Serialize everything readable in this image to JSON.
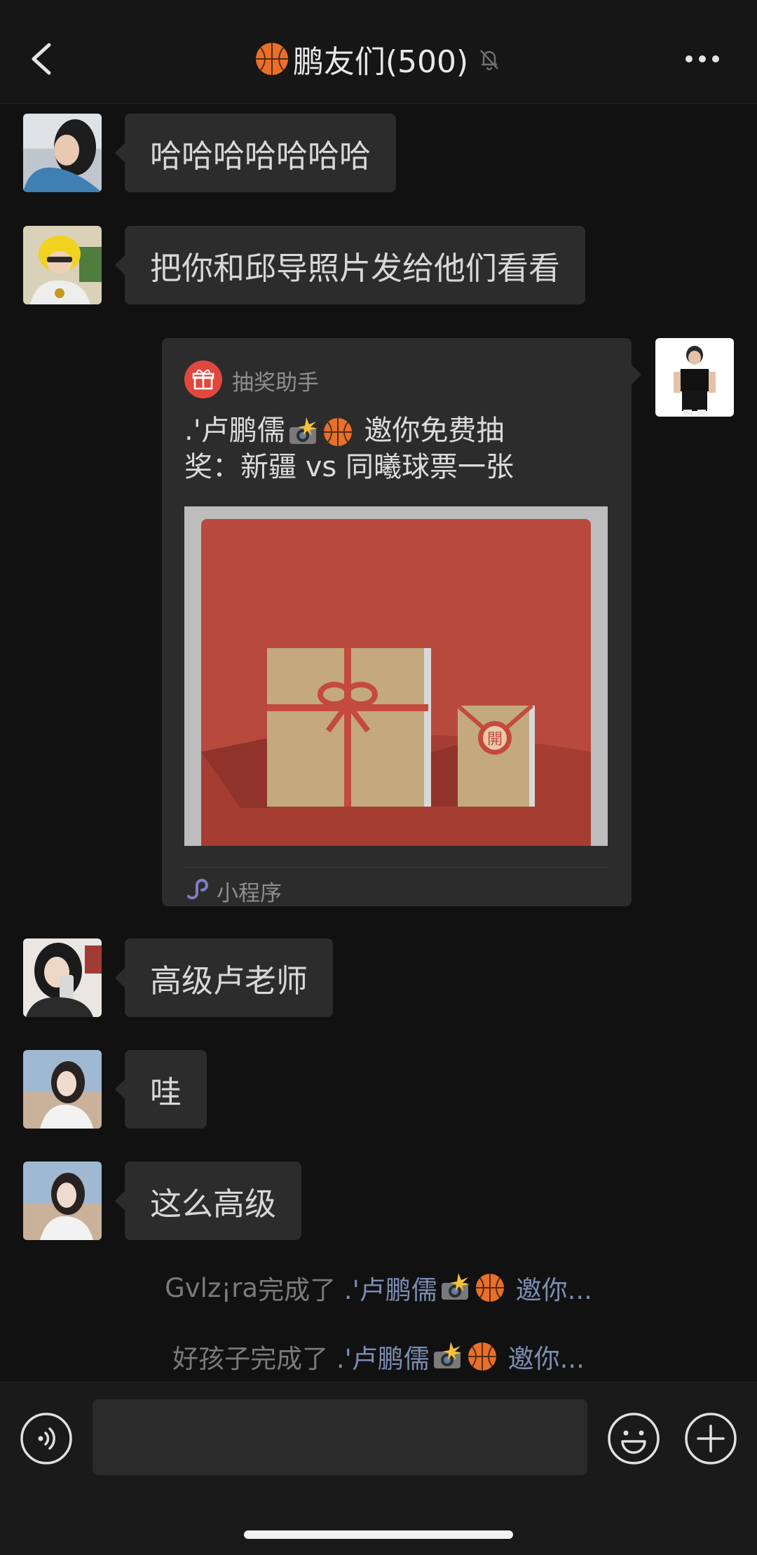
{
  "header": {
    "title": "鹏友们(500)",
    "title_prefix_icon": "basketball-icon",
    "muted_icon": "bell-off-icon",
    "back_icon": "chevron-left-icon",
    "more_icon": "more-dots-icon"
  },
  "messages": [
    {
      "text": "哈哈哈哈哈哈哈"
    },
    {
      "text": "把你和邱导照片发给他们看看"
    },
    {
      "text": "高级卢老师"
    },
    {
      "text": "哇"
    },
    {
      "text": "这么高级"
    }
  ],
  "card": {
    "app_name": "抽奖助手",
    "title_line1_name": ".'卢鹏儒",
    "title_line1_rest": "邀你免费抽",
    "title_line2": "奖：新疆 vs 同曦球票一张",
    "footer_label": "小程序",
    "seal_char": "開",
    "colors": {
      "frame": "#bdbdbd",
      "background": "#b84a3d",
      "box": "#c4a97f",
      "ribbon": "#c44a3e"
    }
  },
  "notices": [
    {
      "actor": "Gvlz¡ra",
      "verb": "完成了",
      "link_name": ".'卢鹏儒",
      "link_tail": "邀你..."
    },
    {
      "actor": "好孩子",
      "verb": "完成了",
      "link_name": ".'卢鹏儒",
      "link_tail": "邀你..."
    }
  ],
  "input": {
    "value": "",
    "placeholder": "",
    "voice_icon": "voice-icon",
    "emoji_icon": "emoji-icon",
    "plus_icon": "plus-icon"
  },
  "colors": {
    "background": "#111111",
    "bubble": "#2c2c2c",
    "link": "#7b8db2"
  }
}
